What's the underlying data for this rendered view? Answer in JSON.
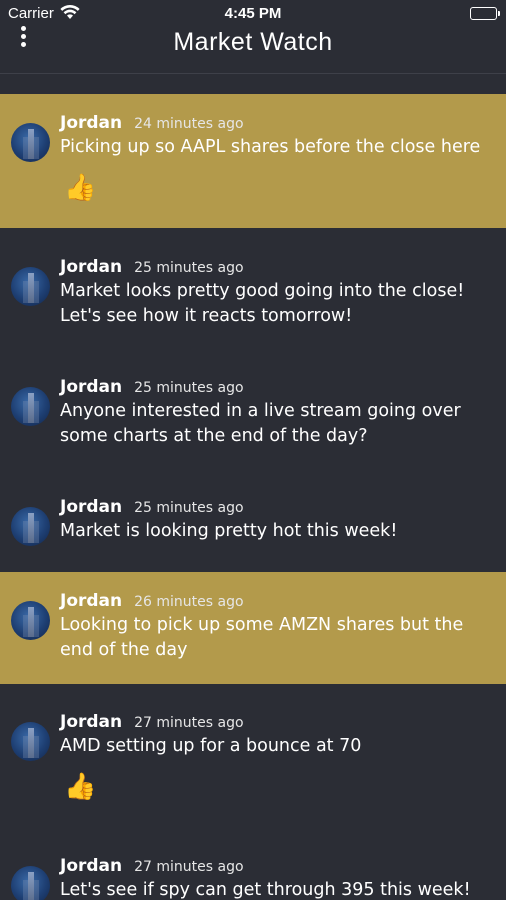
{
  "status_bar": {
    "carrier": "Carrier",
    "time": "4:45 PM",
    "wifi_icon": "wifi-icon",
    "battery_icon": "battery-icon"
  },
  "nav": {
    "title": "Market Watch",
    "menu_icon": "vertical-ellipsis-icon"
  },
  "colors": {
    "background": "#2b2d35",
    "highlight": "#b39a4b"
  },
  "messages": [
    {
      "author": "Jordan",
      "time": "24 minutes ago",
      "text": "Picking up so AAPL shares before the close here",
      "reaction": "👍",
      "highlighted": true
    },
    {
      "author": "Jordan",
      "time": "25 minutes ago",
      "text": "Market looks pretty good going into the close! Let's see how it reacts tomorrow!",
      "reaction": "",
      "highlighted": false
    },
    {
      "author": "Jordan",
      "time": "25 minutes ago",
      "text": "Anyone interested in a live stream going over some charts at the end of the day?",
      "reaction": "",
      "highlighted": false
    },
    {
      "author": "Jordan",
      "time": "25 minutes ago",
      "text": "Market is looking pretty hot this week!",
      "reaction": "",
      "highlighted": false
    },
    {
      "author": "Jordan",
      "time": "26 minutes ago",
      "text": "Looking to pick up some AMZN shares but the end of the day",
      "reaction": "",
      "highlighted": true
    },
    {
      "author": "Jordan",
      "time": "27 minutes ago",
      "text": "AMD setting up for a bounce at 70",
      "reaction": "👍",
      "highlighted": false
    },
    {
      "author": "Jordan",
      "time": "27 minutes ago",
      "text": "Let's see if spy can get through 395 this week!",
      "reaction": "",
      "highlighted": false
    }
  ]
}
